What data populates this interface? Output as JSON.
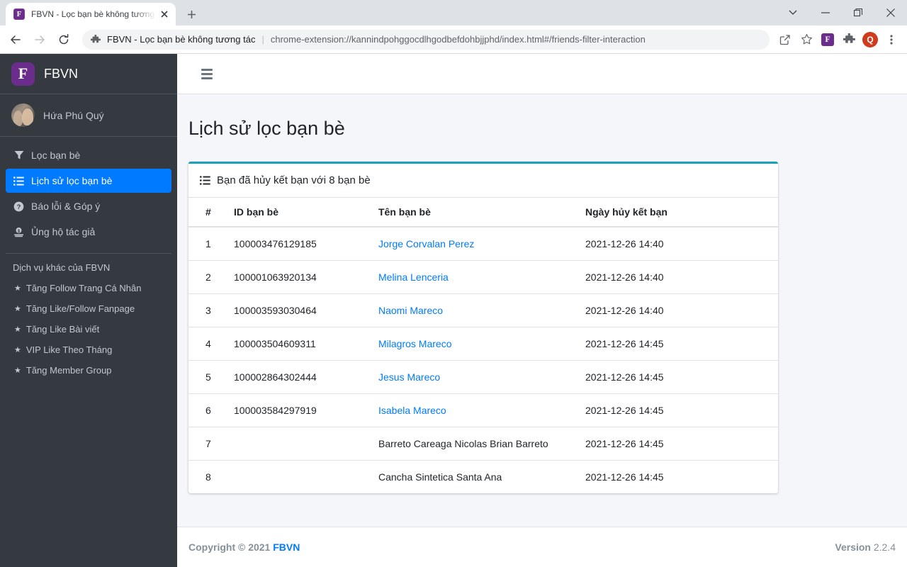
{
  "browser": {
    "tab": {
      "favicon_letter": "F",
      "title": "FBVN - Lọc bạn bè không tương tác",
      "close_icon": "close-icon"
    },
    "new_tab_label": "+",
    "window_controls": [
      "tab-search-chevron",
      "minimize",
      "maximize",
      "close"
    ],
    "omnibox": {
      "extension_name": "FBVN - Lọc bạn bè không tương tác",
      "separator": "|",
      "url": "chrome-extension://kannindpohggocdlhgodbefdohbjjphd/index.html#/friends-filter-interaction",
      "site_icon": "puzzle-piece-icon"
    },
    "toolbar_icons": [
      "back-icon",
      "forward-icon",
      "reload-icon",
      "share-icon",
      "bookmark-star-icon",
      "fbvn-extension-icon",
      "extensions-puzzle-icon",
      "profile-avatar",
      "more-menu-icon"
    ],
    "extension_badge_letter": "F",
    "profile_letter": "Q"
  },
  "sidebar": {
    "brand": {
      "logo_letter": "F",
      "name": "FBVN"
    },
    "user": {
      "name": "Hứa Phú Quý",
      "avatar": "user-avatar"
    },
    "nav": [
      {
        "label": "Lọc bạn bè",
        "icon": "filter-icon",
        "active": false
      },
      {
        "label": "Lịch sử lọc bạn bè",
        "icon": "list-icon",
        "active": true
      },
      {
        "label": "Báo lỗi & Góp ý",
        "icon": "question-circle-icon",
        "active": false
      },
      {
        "label": "Ủng hộ tác giả",
        "icon": "donate-icon",
        "active": false
      }
    ],
    "services_header": "Dịch vụ khác của FBVN",
    "services": [
      {
        "label": "Tăng Follow Trang Cá Nhân",
        "icon": "star-icon"
      },
      {
        "label": "Tăng Like/Follow Fanpage",
        "icon": "star-icon"
      },
      {
        "label": "Tăng Like Bài viết",
        "icon": "star-icon"
      },
      {
        "label": "VIP Like Theo Tháng",
        "icon": "star-icon"
      },
      {
        "label": "Tăng Member Group",
        "icon": "star-icon"
      }
    ]
  },
  "topbar": {
    "menu_toggle_icon": "hamburger-icon"
  },
  "main": {
    "page_title": "Lịch sử lọc bạn bè",
    "card": {
      "header_icon": "list-ul-icon",
      "header_title": "Bạn đã hủy kết bạn với 8 bạn bè",
      "accent_color": "#17a2b8",
      "columns": [
        "#",
        "ID bạn bè",
        "Tên bạn bè",
        "Ngày hủy kết bạn"
      ],
      "rows": [
        {
          "index": "1",
          "id": "100003476129185",
          "name": "Jorge Corvalan Perez",
          "is_link": true,
          "date": "2021-12-26 14:40"
        },
        {
          "index": "2",
          "id": "100001063920134",
          "name": "Melina Lenceria",
          "is_link": true,
          "date": "2021-12-26 14:40"
        },
        {
          "index": "3",
          "id": "100003593030464",
          "name": "Naomi Mareco",
          "is_link": true,
          "date": "2021-12-26 14:40"
        },
        {
          "index": "4",
          "id": "100003504609311",
          "name": "Milagros Mareco",
          "is_link": true,
          "date": "2021-12-26 14:45"
        },
        {
          "index": "5",
          "id": "100002864302444",
          "name": "Jesus Mareco",
          "is_link": true,
          "date": "2021-12-26 14:45"
        },
        {
          "index": "6",
          "id": "100003584297919",
          "name": "Isabela Mareco",
          "is_link": true,
          "date": "2021-12-26 14:45"
        },
        {
          "index": "7",
          "id": "",
          "name": "Barreto Careaga Nicolas Brian Barreto",
          "is_link": false,
          "date": "2021-12-26 14:45"
        },
        {
          "index": "8",
          "id": "",
          "name": "Cancha Sintetica Santa Ana",
          "is_link": false,
          "date": "2021-12-26 14:45"
        }
      ]
    }
  },
  "footer": {
    "copyright_prefix": "Copyright © 2021 ",
    "brand": "FBVN",
    "version_label": "Version ",
    "version_number": "2.2.4"
  },
  "colors": {
    "sidebar_bg": "#343a40",
    "active_nav": "#007bff",
    "card_accent": "#17a2b8",
    "content_bg": "#f4f6f9",
    "link": "#007bff",
    "brand_purple": "#6b2d8b"
  }
}
